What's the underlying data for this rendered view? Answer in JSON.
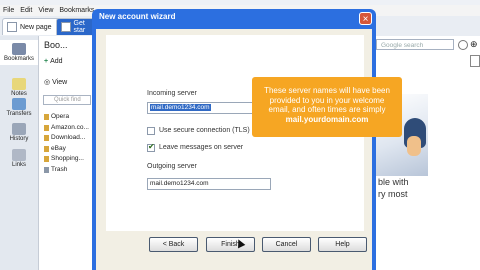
{
  "menu": [
    "File",
    "Edit",
    "View",
    "Bookmarks"
  ],
  "tabs": [
    "New page",
    "Get star"
  ],
  "left_nav": [
    "Bookmarks",
    "Notes",
    "Transfers",
    "History",
    "Links"
  ],
  "bookmarks_panel": {
    "title": "Boo...",
    "add_label": "Add",
    "view_label": "View",
    "search_placeholder": "Quick find",
    "items": [
      "Opera",
      "Amazon.co...",
      "Download...",
      "eBay",
      "Shopping...",
      "Trash"
    ]
  },
  "search_box": {
    "placeholder": "Google search"
  },
  "page_text": [
    "ble with",
    "ry most"
  ],
  "dialog": {
    "title": "New account wizard",
    "incoming_label": "Incoming server",
    "incoming_value": "mail.demo1234.com",
    "secure_label": "Use secure connection (TLS)",
    "leave_label": "Leave messages on server",
    "leave_checked": true,
    "secure_checked": false,
    "outgoing_label": "Outgoing server",
    "outgoing_value": "mail.demo1234.com",
    "buttons": {
      "back": "< Back",
      "finish": "Finish",
      "cancel": "Cancel",
      "help": "Help"
    }
  },
  "callout": {
    "lines": [
      "These server names will have been",
      "provided to you in your welcome",
      "email, and often times are simply"
    ],
    "bold": "mail.yourdomain.com"
  }
}
